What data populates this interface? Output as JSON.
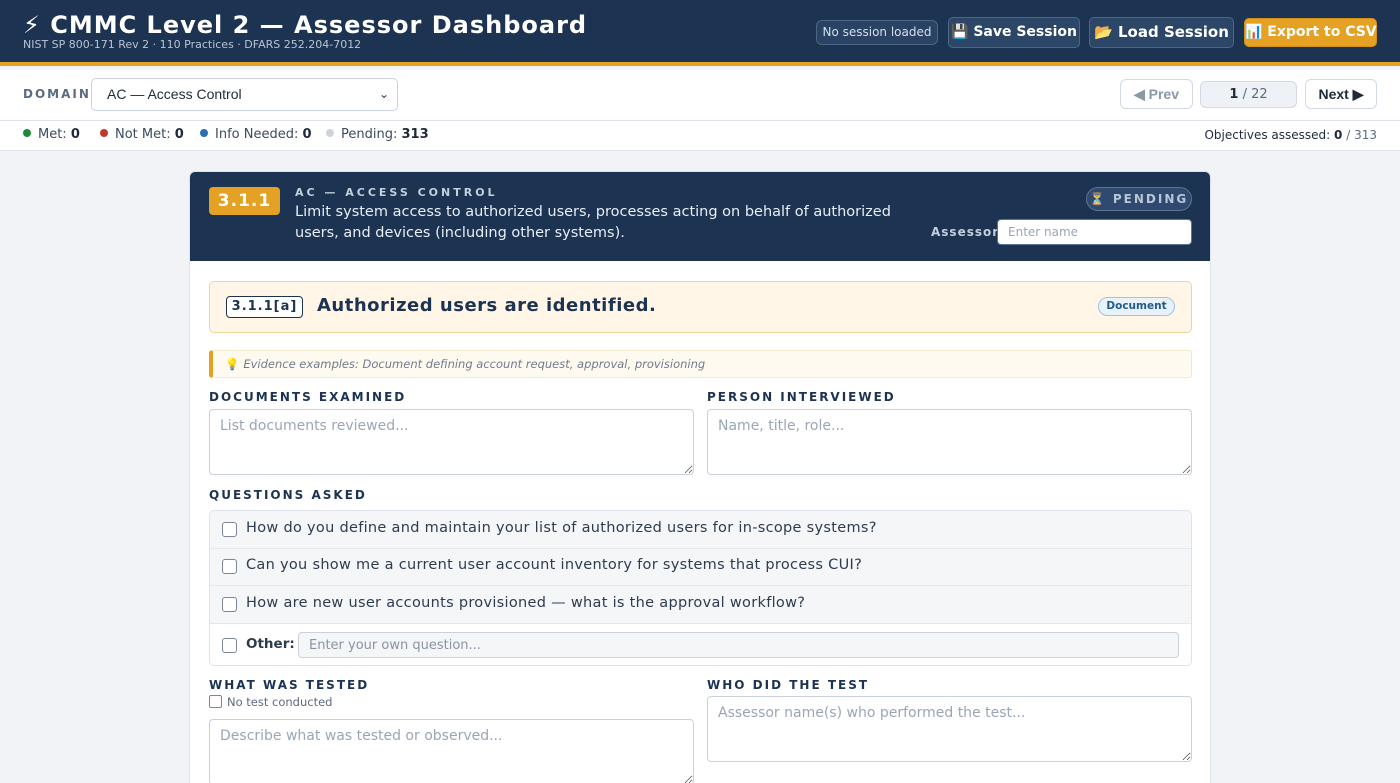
{
  "header": {
    "title": "⚡ CMMC Level 2 — Assessor Dashboard",
    "subtitle": "NIST SP 800-171 Rev 2 · 110 Practices · DFARS 252.204-7012",
    "session_status": "No session loaded",
    "save_label": "💾 Save Session",
    "load_label": "📂 Load Session",
    "export_label": "📊 Export to CSV",
    "colors": {
      "navy": "#1d3352",
      "accent": "#e5a124"
    }
  },
  "domain_bar": {
    "label": "DOMAIN",
    "selected_domain": "AC — Access Control",
    "prev_label": "◀ Prev",
    "next_label": "Next ▶",
    "current_page": "1",
    "total_pages": "/ 22"
  },
  "stats": {
    "met_label": "Met:",
    "met_value": "0",
    "met_color": "#1e8a3c",
    "not_met_label": "Not Met:",
    "not_met_value": "0",
    "not_met_color": "#c0392b",
    "info_label": "Info Needed:",
    "info_value": "0",
    "info_color": "#2d6fb5",
    "pending_label": "Pending:",
    "pending_value": "313",
    "pending_color": "#cdd4dd",
    "assessed_label": "Objectives assessed:",
    "assessed_value": "0",
    "assessed_total": "/ 313"
  },
  "practice": {
    "id": "3.1.1",
    "domain": "AC — ACCESS CONTROL",
    "text": "Limit system access to authorized users, processes acting on behalf of authorized users, and devices (including other systems).",
    "status": "⏳ PENDING",
    "assessor_label": "Assessor:",
    "assessor_placeholder": "Enter name"
  },
  "objective": {
    "id": "3.1.1[a]",
    "title": "Authorized users are identified.",
    "type": "Document",
    "evidence": "Evidence examples: Document defining account request, approval, provisioning",
    "evidence_icon": "lightbulb-icon"
  },
  "fields": {
    "documents_label": "DOCUMENTS EXAMINED",
    "documents_placeholder": "List documents reviewed...",
    "person_label": "PERSON INTERVIEWED",
    "person_placeholder": "Name, title, role...",
    "questions_label": "QUESTIONS ASKED",
    "questions": [
      "How do you define and maintain your list of authorized users for in-scope systems?",
      "Can you show me a current user account inventory for systems that process CUI?",
      "How are new user accounts provisioned — what is the approval workflow?"
    ],
    "other_label": "Other:",
    "other_placeholder": "Enter your own question...",
    "tested_label": "WHAT WAS TESTED",
    "no_test_label": "No test conducted",
    "tested_placeholder": "Describe what was tested or observed...",
    "who_label": "WHO DID THE TEST",
    "who_placeholder": "Assessor name(s) who performed the test..."
  }
}
